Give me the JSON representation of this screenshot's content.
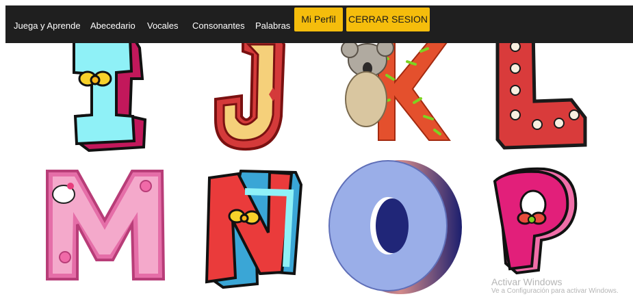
{
  "navbar": {
    "links": [
      "Juega y Aprende",
      "Abecedario",
      "Vocales",
      "Consonantes",
      "Palabras"
    ],
    "profile_button": "Mi Perfil",
    "logout_button": "CERRAR SESION",
    "button_color": "#f5bd0c",
    "background": "#1f1f1f"
  },
  "letters": [
    {
      "letter": "I",
      "style": "cartoon cyan with bow"
    },
    {
      "letter": "J",
      "style": "circus yellow and red"
    },
    {
      "letter": "K",
      "style": "orange with koala"
    },
    {
      "letter": "L",
      "style": "red marquee lights"
    },
    {
      "letter": "M",
      "style": "pink with cat and flowers"
    },
    {
      "letter": "N",
      "style": "red and cyan cartoon with bow"
    },
    {
      "letter": "O",
      "style": "3D blue"
    },
    {
      "letter": "P",
      "style": "pink cartoon with bow"
    }
  ],
  "watermark": {
    "title": "Activar Windows",
    "subtitle": "Ve a Configuración para activar Windows."
  }
}
